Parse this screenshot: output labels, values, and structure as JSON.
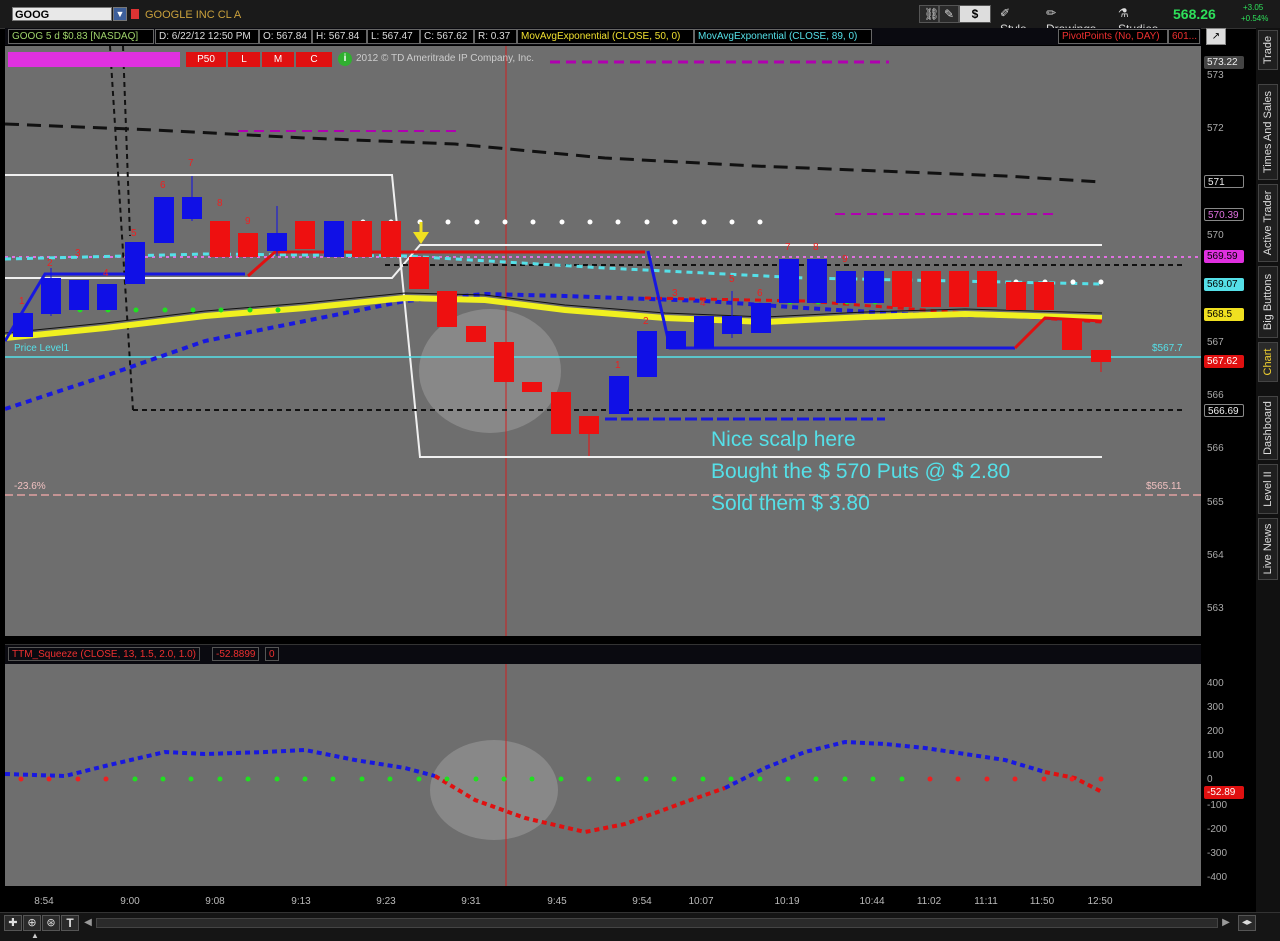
{
  "toolbar": {
    "symbol": "GOOG",
    "company": "GOOGLE INC CL A",
    "dollar_label": "$",
    "style_label": "Style",
    "drawings_label": "Drawings",
    "studies_label": "Studies",
    "last_price": "568.26",
    "change_abs": "+3.05",
    "change_pct": "+0.54%"
  },
  "header": {
    "symbol_info": "GOOG 5 d $0.83 [NASDAQ]",
    "date": "D: 6/22/12 12:50 PM",
    "open": "O: 567.84",
    "high": "H: 567.84",
    "low": "L: 567.47",
    "close": "C: 567.62",
    "range": "R: 0.37",
    "study1": "MovAvgExponential (CLOSE, 50, 0)",
    "study2": "MovAvgExponential (CLOSE, 89, 0)",
    "pivot": "PivotPoints (No, DAY)",
    "pivot_trunc": "601..."
  },
  "overlay": {
    "toggles": [
      "P50",
      "L",
      "M",
      "C"
    ],
    "copyright": "2012 © TD Ameritrade IP Company, Inc.",
    "price_level_label": "Price Level1",
    "price_level_value": "$567.7",
    "fib_label": "-23.6%",
    "fib_value": "$565.11"
  },
  "annotation": {
    "line1": "Nice scalp here",
    "line2": "Bought the $ 570 Puts @ $ 2.80",
    "line3": "Sold them $ 3.80"
  },
  "lower": {
    "study": "TTM_Squeeze (CLOSE, 13, 1.5, 2.0, 1.0)",
    "value": "-52.8899",
    "value2": "0",
    "badge": "-52.89"
  },
  "yaxis": {
    "labels": [
      "573",
      "572",
      "570",
      "568",
      "567",
      "566",
      "565",
      "564",
      "563"
    ],
    "lower_labels": [
      "400",
      "300",
      "200",
      "100",
      "0",
      "-100",
      "-200",
      "-300",
      "-400"
    ],
    "badges": {
      "top": "573.22",
      "b571": "571",
      "ma1": "570.39",
      "pivot": "569.59",
      "cyan": "569.07",
      "yellow": "568.5",
      "last": "567.62",
      "black": "566.69"
    }
  },
  "xaxis": {
    "labels": [
      "8:54",
      "9:00",
      "9:08",
      "9:13",
      "9:23",
      "9:31",
      "9:45",
      "9:54",
      "10:07",
      "10:19",
      "10:44",
      "11:02",
      "11:11",
      "11:50",
      "12:50"
    ]
  },
  "sidebar": {
    "tabs": [
      "Trade",
      "Times And Sales",
      "Active Trader",
      "Big Buttons",
      "Chart",
      "Dashboard",
      "Level II",
      "Live News"
    ]
  },
  "colors": {
    "up": "#1010e6",
    "down": "#ee1010",
    "bg": "#6e6e6e",
    "cyan": "#55e0e8"
  }
}
